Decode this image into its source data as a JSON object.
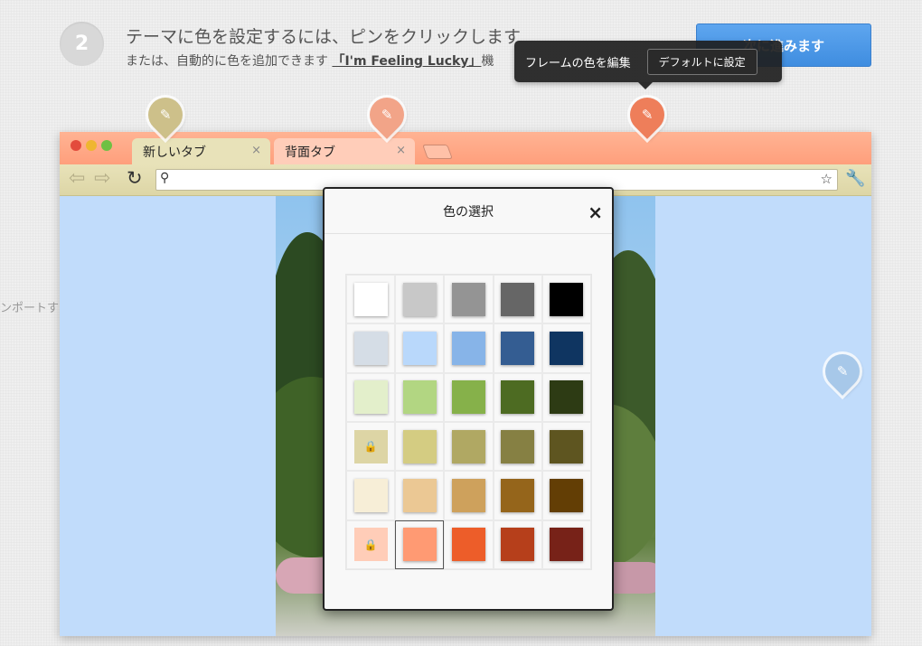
{
  "step": {
    "number": "2"
  },
  "heading": "テーマに色を設定するには、ピンをクリックします",
  "subheading": {
    "prefix": "または、自動的に色を追加できます",
    "lucky_link": "「I'm Feeling Lucky」",
    "suffix": "機"
  },
  "next_button": "次に進みます",
  "side_text": "ンポートする",
  "tooltip": {
    "label": "フレームの色を編集",
    "button": "デフォルトに設定"
  },
  "browser": {
    "tabs": [
      {
        "label": "新しいタブ",
        "close": "×"
      },
      {
        "label": "背面タブ",
        "close": "×"
      }
    ]
  },
  "colors": {
    "frame": "#ff9f7c",
    "toolbar": "#e5dfb3",
    "content_bg": "#c1dcfb",
    "accent": "#3f8de0"
  },
  "dialog": {
    "title": "色の選択",
    "close": "×",
    "swatches": [
      [
        "#ffffff",
        "#c8c8c8",
        "#949494",
        "#666666",
        "#000000"
      ],
      [
        "#d5dde6",
        "#b9d8fb",
        "#87b4e8",
        "#345d92",
        "#0f3561"
      ],
      [
        "#e3efcb",
        "#b2d682",
        "#86b14a",
        "#4d6b22",
        "#2d3b14"
      ],
      [
        "#ddd5a5",
        "#d4cc82",
        "#b0a863",
        "#868043",
        "#5e5520"
      ],
      [
        "#f7eed7",
        "#ebc894",
        "#cea15c",
        "#95651b",
        "#633e05"
      ],
      [
        "#ffcdb8",
        "#ff9a73",
        "#ed5d29",
        "#b63f1b",
        "#772218"
      ]
    ],
    "locked": [
      [
        3,
        0
      ],
      [
        5,
        0
      ]
    ],
    "selected": [
      5,
      1
    ]
  }
}
